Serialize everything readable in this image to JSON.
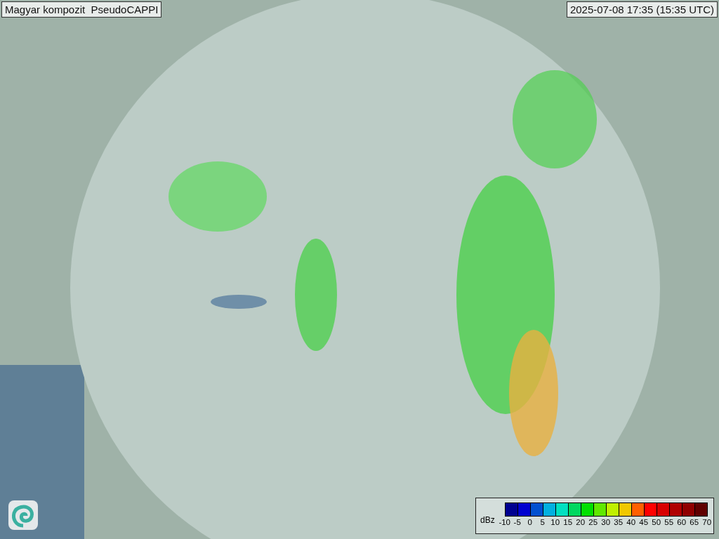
{
  "title": "Magyar kompozit  PseudoCAPPI",
  "timestamp": "2025-07-08 17:35 (15:35 UTC)",
  "legend": {
    "unit": "dBz",
    "bins": [
      {
        "color": "#000090"
      },
      {
        "color": "#0000d0"
      },
      {
        "color": "#0050d0"
      },
      {
        "color": "#00b0e0"
      },
      {
        "color": "#00e0c0"
      },
      {
        "color": "#00d860"
      },
      {
        "color": "#00e000"
      },
      {
        "color": "#60e800"
      },
      {
        "color": "#c0f000"
      },
      {
        "color": "#f0c800"
      },
      {
        "color": "#ff6000"
      },
      {
        "color": "#ff0000"
      },
      {
        "color": "#d80000"
      },
      {
        "color": "#b00000"
      },
      {
        "color": "#900000"
      },
      {
        "color": "#600000"
      }
    ],
    "ticks": [
      "-10",
      "-5",
      "0",
      "5",
      "10",
      "15",
      "20",
      "25",
      "30",
      "35",
      "40",
      "45",
      "50",
      "55",
      "60",
      "65",
      "70"
    ]
  }
}
